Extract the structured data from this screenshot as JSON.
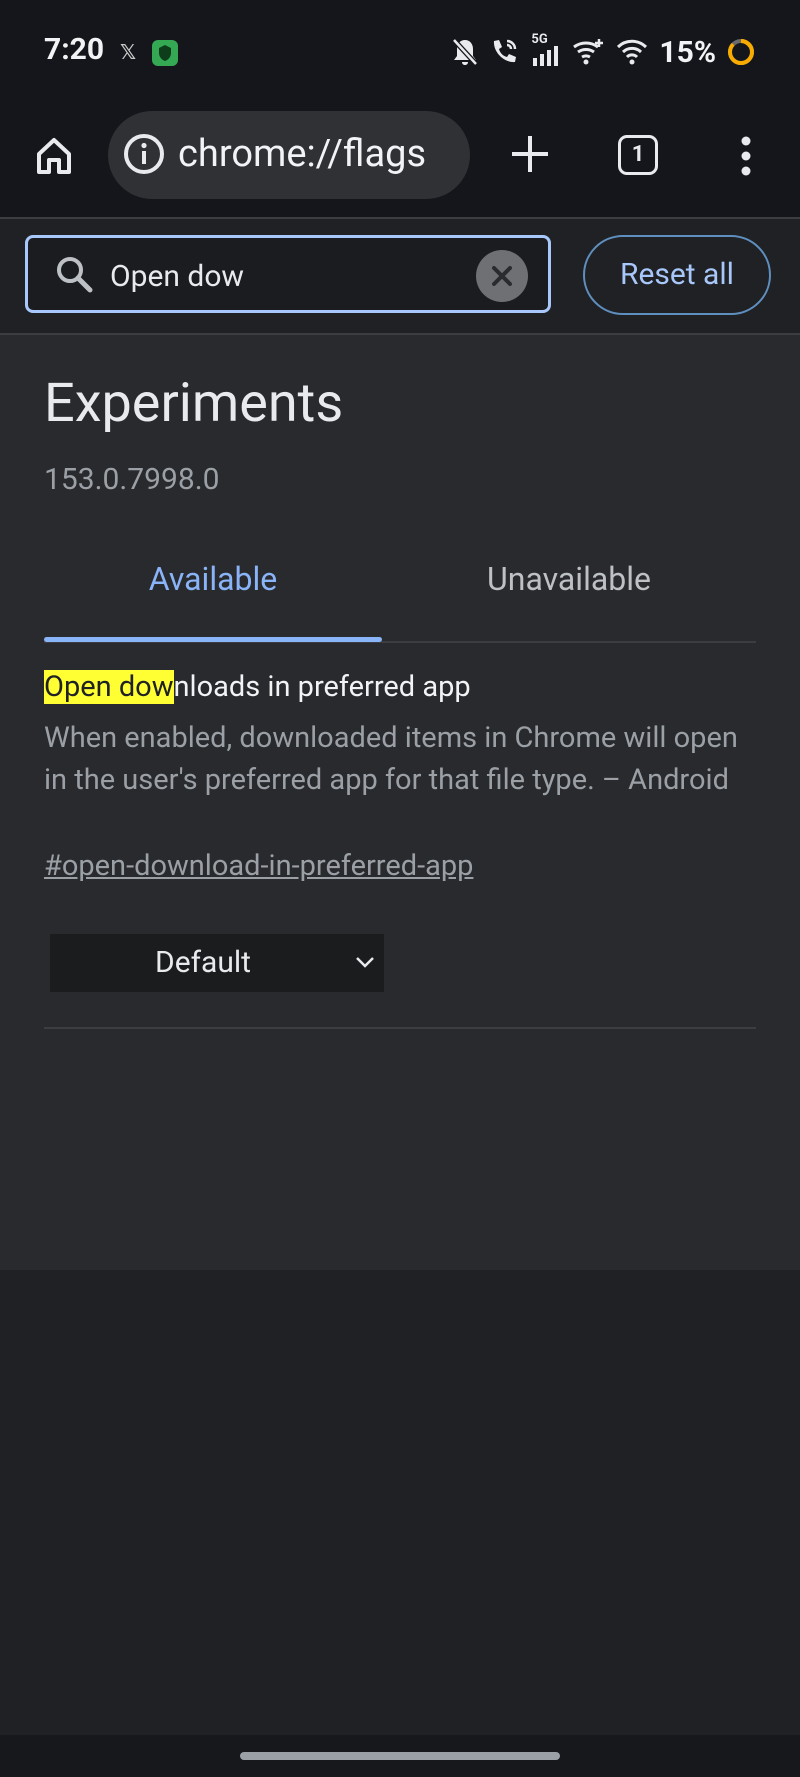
{
  "status_bar": {
    "time": "7:20",
    "battery": "15%",
    "network": "5G"
  },
  "toolbar": {
    "url": "chrome://flags",
    "tab_count": "1"
  },
  "search": {
    "value": "Open dow",
    "reset_label": "Reset all"
  },
  "page": {
    "title": "Experiments",
    "version": "153.0.7998.0",
    "tabs": [
      {
        "label": "Available",
        "active": true
      },
      {
        "label": "Unavailable",
        "active": false
      }
    ]
  },
  "flag": {
    "title_match": "Open dow",
    "title_rest": "nloads in preferred app",
    "description": "When enabled, downloaded items in Chrome will open in the user's preferred app for that file type. – Android",
    "link": "#open-download-in-preferred-app",
    "selected_option": "Default"
  },
  "colors": {
    "accent": "#8ab4f8",
    "highlight": "#ffff33",
    "background": "#292a2d"
  }
}
